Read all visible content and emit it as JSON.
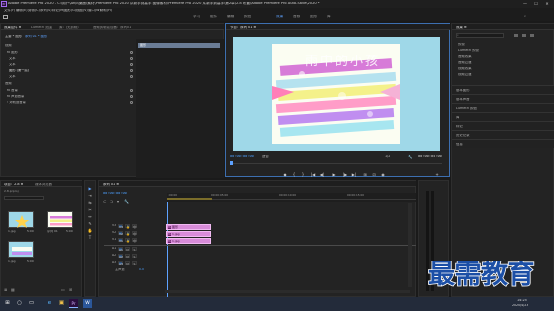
{
  "window": {
    "title": "Adobe Premiere Pro 2020 - C:\\用户\\Ahp\\桌面\\素材\\Premiere Pro 2020 从新手到高手 图像素材\\Premiere Pro 2020 从新手到高手\\第2章\\2.8 布置\\Adobe Premiere Pro Auto-Save\\2020 *",
    "app_logo": "Pr",
    "controls": [
      "—",
      "☐",
      "✕"
    ]
  },
  "menu": [
    "文件(F)",
    "编辑(E)",
    "剪辑(C)",
    "序列(S)",
    "标记(M)",
    "图形(G)",
    "视图(V)",
    "窗口(W)",
    "帮助(H)"
  ],
  "workspaces": {
    "items": [
      "学习",
      "组件",
      "编辑",
      "颜色",
      "效果",
      "音频",
      "图形",
      "库"
    ],
    "active_index": 4
  },
  "effect_controls": {
    "tabs": [
      "效果控件 ≡",
      "Lumetri 范围",
      "源：(无剪辑)",
      "音频剪辑混合器：序列01"
    ],
    "master": "主要 * 图形",
    "sequence": "序列 01 * 图形",
    "rows": [
      "视频",
      "fx  图形",
      "文本",
      "文本",
      "图形 (第一层)",
      "文本",
      "音频",
      "fx  音量",
      "fx  声道音量",
      "› 对轨道音量"
    ],
    "clip_label": "图形"
  },
  "program": {
    "tab": "节目：序列 01 ≡",
    "timecode_left": "00:00:00:00",
    "fit": "适合",
    "quality": "1/2",
    "timecode_right": "00:00:05:00",
    "image_caption": "雨中的小孩",
    "image_colors": {
      "sky": "#9fd8e8",
      "bg": "#fbfdf2",
      "arrow": "#ff7fb8",
      "stripe1": "#d77bd8",
      "stripe2": "#b5e2ef",
      "stripe3": "#f4f18a",
      "stripe4": "#ff9dc8",
      "stripe5": "#c08ef0"
    }
  },
  "transport": [
    "◆",
    "{",
    "}",
    "|◀",
    "◀|",
    "▶",
    "|▶",
    "▶|",
    "⊞",
    "⊡",
    "◉",
    "+"
  ],
  "right_panel": {
    "tabs": [
      "效果 ≡"
    ],
    "search_placeholder": "",
    "items": [
      "预设",
      "Lumetri 预设",
      "音频效果",
      "音频过渡",
      "视频效果",
      "视频过渡"
    ],
    "sections": [
      "基本图形",
      "基本声音",
      "Lumetri 颜色",
      "库",
      "标记",
      "历史记录",
      "信息"
    ]
  },
  "project": {
    "tabs": [
      "项目：2.8 ≡",
      "媒体浏览器"
    ],
    "file": "2.8.prproj",
    "items": [
      "1.jpg",
      "序列 01",
      "1.jpg"
    ],
    "item_times": [
      "5:00",
      "5:00",
      "5:00"
    ]
  },
  "timeline": {
    "tab": "序列 01 ≡",
    "timecode": "00:00:00:00",
    "ruler": [
      ":00:00",
      "00:00:05:00",
      "00:00:10:00",
      "00:00:15:00"
    ],
    "video_tracks": [
      "V3",
      "V2",
      "V1"
    ],
    "audio_tracks": [
      "A1",
      "A2",
      "A3"
    ],
    "master": "主声道",
    "master_value": "0.0",
    "clips": [
      "图形",
      "1.jpg",
      "1.jpg"
    ]
  },
  "tools": [
    "▶",
    "⇥",
    "⇆",
    "✂",
    "↔",
    "✎",
    "✋",
    "T"
  ],
  "taskbar": {
    "apps": [
      "⊞",
      "○",
      "▭",
      "e",
      "▣",
      "Pr",
      "W"
    ],
    "time": "14:25",
    "date": "2020/4/23"
  },
  "watermark": {
    "text": "最需教育"
  }
}
